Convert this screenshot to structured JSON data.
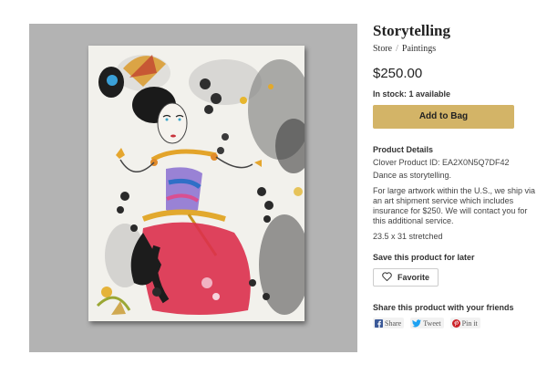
{
  "product": {
    "title": "Storytelling",
    "breadcrumb": [
      "Store",
      "/",
      "Paintings"
    ],
    "price": "$250.00",
    "stock": "In stock: 1 available",
    "add_to_bag": "Add to Bag"
  },
  "details": {
    "heading": "Product Details",
    "product_id": "Clover Product ID: EA2X0N5Q7DF42",
    "description": "Dance as storytelling.",
    "shipping": "For large artwork within the U.S., we ship via an art shipment service which includes insurance for $250. We will contact you for this additional service.",
    "size": "23.5 x 31 stretched"
  },
  "save": {
    "heading": "Save this product for later",
    "favorite": "Favorite"
  },
  "share": {
    "heading": "Share this product with your friends",
    "buttons": [
      {
        "label": "Share",
        "icon": "facebook-icon",
        "color": "#3b5998"
      },
      {
        "label": "Tweet",
        "icon": "twitter-icon",
        "color": "#1da1f2"
      },
      {
        "label": "Pin it",
        "icon": "pinterest-icon",
        "color": "#cb2027"
      }
    ]
  },
  "colors": {
    "accent_button": "#d3b467",
    "image_backdrop": "#b3b3b3"
  }
}
